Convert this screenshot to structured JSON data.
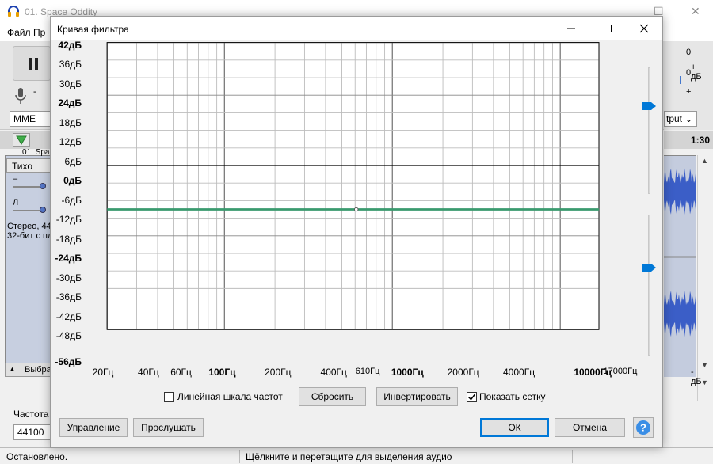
{
  "background_app": {
    "title": "01. Space Oddity",
    "menu": [
      "Файл",
      "Пр"
    ],
    "host": "MME",
    "output_device_fragment": "tput",
    "meter_values": [
      "0",
      "0"
    ],
    "meter_plus": "+",
    "meter_minus": "-",
    "timeline_time": "1:30",
    "track_name_fragment": "01. Spac",
    "mute_label": "Тихо",
    "gain_minus": "–",
    "pan_left": "Л",
    "track_info_line1": "Стерео, 44",
    "track_info_line2": "32-бит с пл",
    "select_label": "Выбра",
    "rate_label": "Частота",
    "rate_value": "44100",
    "status_left": "Остановлено.",
    "status_mid": "Щёлкните и перетащите для выделения аудио"
  },
  "dialog": {
    "title": "Кривая фильтра",
    "db_top": "+ дБ",
    "db_bottom": "- дБ",
    "checkboxes": {
      "linear_label": "Линейная шкала частот",
      "linear_checked": false,
      "grid_label": "Показать сетку",
      "grid_checked": true
    },
    "buttons": {
      "reset": "Сбросить",
      "invert": "Инвертировать",
      "manage": "Управление",
      "preview": "Прослушать",
      "ok": "ОК",
      "cancel": "Отмена",
      "help": "?"
    },
    "colors": {
      "curve": "#3a9a6e",
      "accent": "#0078d7"
    }
  },
  "chart_data": {
    "type": "line",
    "title": "",
    "x_scale": "log",
    "x_range": [
      20,
      17000
    ],
    "y_range": [
      -56,
      42
    ],
    "y_unit": "дБ",
    "y_ticks": [
      {
        "label": "42дБ",
        "value": 42,
        "bold": true
      },
      {
        "label": "36дБ",
        "value": 36,
        "bold": false
      },
      {
        "label": "30дБ",
        "value": 30,
        "bold": false
      },
      {
        "label": "24дБ",
        "value": 24,
        "bold": true
      },
      {
        "label": "18дБ",
        "value": 18,
        "bold": false
      },
      {
        "label": "12дБ",
        "value": 12,
        "bold": false
      },
      {
        "label": "6дБ",
        "value": 6,
        "bold": false
      },
      {
        "label": "0дБ",
        "value": 0,
        "bold": true
      },
      {
        "label": "-6дБ",
        "value": -6,
        "bold": false
      },
      {
        "label": "-12дБ",
        "value": -12,
        "bold": false
      },
      {
        "label": "-18дБ",
        "value": -18,
        "bold": false
      },
      {
        "label": "-24дБ",
        "value": -24,
        "bold": true
      },
      {
        "label": "-30дБ",
        "value": -30,
        "bold": false
      },
      {
        "label": "-36дБ",
        "value": -36,
        "bold": false
      },
      {
        "label": "-42дБ",
        "value": -42,
        "bold": false
      },
      {
        "label": "-48дБ",
        "value": -48,
        "bold": false
      },
      {
        "label": "-56дБ",
        "value": -56,
        "bold": true
      }
    ],
    "x_ticks": [
      {
        "label": "20Гц",
        "value": 20,
        "bold": false,
        "small": false
      },
      {
        "label": "40Гц",
        "value": 40,
        "bold": false,
        "small": false
      },
      {
        "label": "60Гц",
        "value": 60,
        "bold": false,
        "small": false
      },
      {
        "label": "100Гц",
        "value": 100,
        "bold": true,
        "small": false
      },
      {
        "label": "200Гц",
        "value": 200,
        "bold": false,
        "small": false
      },
      {
        "label": "400Гц",
        "value": 400,
        "bold": false,
        "small": false
      },
      {
        "label": "610Гц",
        "value": 610,
        "bold": false,
        "small": true
      },
      {
        "label": "1000Гц",
        "value": 1000,
        "bold": true,
        "small": false
      },
      {
        "label": "2000Гц",
        "value": 2000,
        "bold": false,
        "small": false
      },
      {
        "label": "4000Гц",
        "value": 4000,
        "bold": false,
        "small": false
      },
      {
        "label": "10000Гц",
        "value": 10000,
        "bold": true,
        "small": false
      },
      {
        "label": "17000Гц",
        "value": 17000,
        "bold": false,
        "small": true
      }
    ],
    "series": [
      {
        "points": [
          [
            20,
            -15
          ],
          [
            17000,
            -15
          ]
        ]
      }
    ],
    "control_points": [
      [
        610,
        -15
      ]
    ],
    "grid": true
  }
}
